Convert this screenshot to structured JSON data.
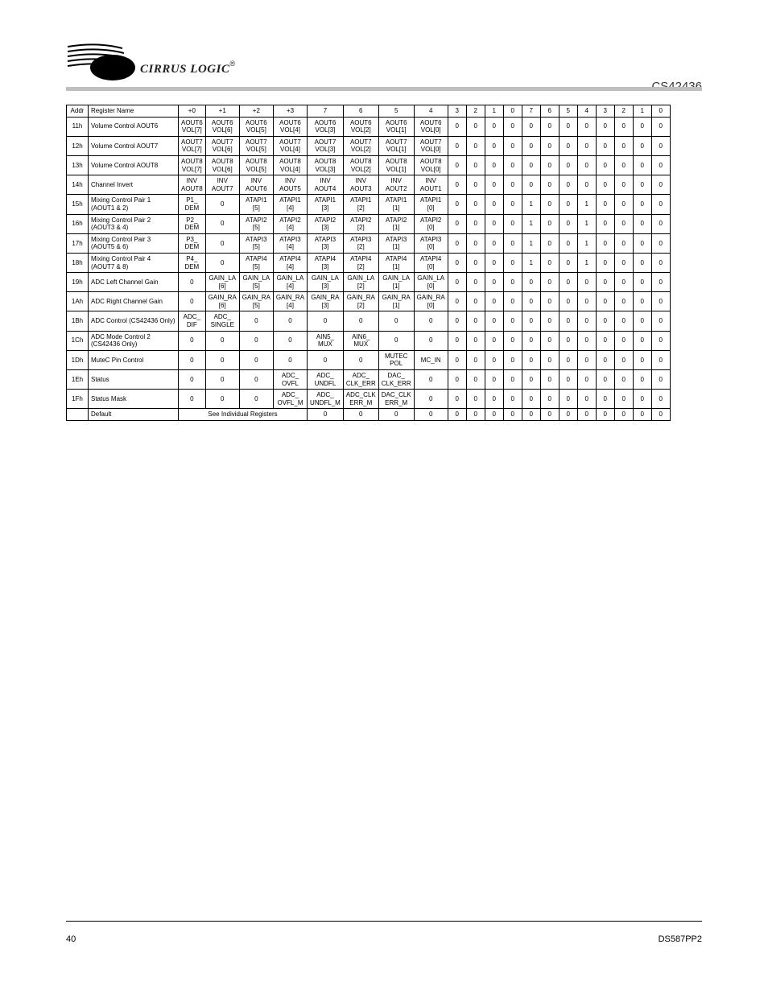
{
  "header": {
    "logo_text": "CIRRUS LOGIC",
    "registered": "®",
    "product_id": "CS42436"
  },
  "table": {
    "head": {
      "addr": "Addr",
      "name": "Register Name",
      "bytes": [
        "+0",
        "+1",
        "+2",
        "+3"
      ],
      "bits": [
        "7",
        "6",
        "5",
        "4",
        "3",
        "2",
        "1",
        "0",
        "7",
        "6",
        "5",
        "4",
        "3",
        "2",
        "1",
        "0"
      ]
    },
    "rows": [
      {
        "addr": "11h",
        "name": "Volume Control AOUT6",
        "b0": [
          "AOUT6\nVOL[7]",
          "AOUT6\nVOL[6]",
          "AOUT6\nVOL[5]",
          "AOUT6\nVOL[4]",
          "AOUT6\nVOL[3]",
          "AOUT6\nVOL[2]",
          "AOUT6\nVOL[1]",
          "AOUT6\nVOL[0]"
        ],
        "b1": [
          "0",
          "0",
          "0",
          "0",
          "0",
          "0",
          "0",
          "0"
        ],
        "b2": [
          "0",
          "0",
          "0",
          "0",
          "0",
          "0",
          "0",
          "0"
        ],
        "b3": [
          "0",
          "0",
          "0",
          "0",
          "0",
          "0",
          "0",
          "0"
        ]
      },
      {
        "addr": "12h",
        "name": "Volume Control AOUT7",
        "b0": [
          "AOUT7\nVOL[7]",
          "AOUT7\nVOL[6]",
          "AOUT7\nVOL[5]",
          "AOUT7\nVOL[4]",
          "AOUT7\nVOL[3]",
          "AOUT7\nVOL[2]",
          "AOUT7\nVOL[1]",
          "AOUT7\nVOL[0]"
        ],
        "b1": [
          "0",
          "0",
          "0",
          "0",
          "0",
          "0",
          "0",
          "0"
        ],
        "b2": [
          "0",
          "0",
          "0",
          "0",
          "0",
          "0",
          "0",
          "0"
        ],
        "b3": [
          "0",
          "0",
          "0",
          "0",
          "0",
          "0",
          "0",
          "0"
        ]
      },
      {
        "addr": "13h",
        "name": "Volume Control AOUT8",
        "b0": [
          "AOUT8\nVOL[7]",
          "AOUT8\nVOL[6]",
          "AOUT8\nVOL[5]",
          "AOUT8\nVOL[4]",
          "AOUT8\nVOL[3]",
          "AOUT8\nVOL[2]",
          "AOUT8\nVOL[1]",
          "AOUT8\nVOL[0]"
        ],
        "b1": [
          "0",
          "0",
          "0",
          "0",
          "0",
          "0",
          "0",
          "0"
        ],
        "b2": [
          "0",
          "0",
          "0",
          "0",
          "0",
          "0",
          "0",
          "0"
        ],
        "b3": [
          "0",
          "0",
          "0",
          "0",
          "0",
          "0",
          "0",
          "0"
        ]
      },
      {
        "addr": "14h",
        "name": "Channel Invert",
        "b0": [
          "INV\nAOUT8",
          "INV\nAOUT7",
          "INV\nAOUT6",
          "INV\nAOUT5",
          "INV\nAOUT4",
          "INV\nAOUT3",
          "INV\nAOUT2",
          "INV\nAOUT1"
        ],
        "b1": [
          "0",
          "0",
          "0",
          "0",
          "0",
          "0",
          "0",
          "0"
        ],
        "b2": [
          "0",
          "0",
          "0",
          "0",
          "0",
          "0",
          "0",
          "0"
        ],
        "b3": [
          "0",
          "0",
          "0",
          "0",
          "0",
          "0",
          "0",
          "0"
        ]
      },
      {
        "addr": "15h",
        "name": "Mixing Control Pair 1 (AOUT1 & 2)",
        "b0": [
          "P1_\nDEM",
          "0",
          "ATAPI1\n[5]",
          "ATAPI1\n[4]",
          "ATAPI1\n[3]",
          "ATAPI1\n[2]",
          "ATAPI1\n[1]",
          "ATAPI1\n[0]"
        ],
        "b1": [
          "0",
          "0",
          "0",
          "0",
          "1",
          "0",
          "0",
          "1"
        ],
        "b2": [
          "0",
          "0",
          "0",
          "0",
          "0",
          "0",
          "0",
          "0"
        ],
        "b3": [
          "0",
          "0",
          "0",
          "0",
          "0",
          "0",
          "0",
          "0"
        ]
      },
      {
        "addr": "16h",
        "name": "Mixing Control Pair 2 (AOUT3 & 4)",
        "b0": [
          "P2_\nDEM",
          "0",
          "ATAPI2\n[5]",
          "ATAPI2\n[4]",
          "ATAPI2\n[3]",
          "ATAPI2\n[2]",
          "ATAPI2\n[1]",
          "ATAPI2\n[0]"
        ],
        "b1": [
          "0",
          "0",
          "0",
          "0",
          "1",
          "0",
          "0",
          "1"
        ],
        "b2": [
          "0",
          "0",
          "0",
          "0",
          "0",
          "0",
          "0",
          "0"
        ],
        "b3": [
          "0",
          "0",
          "0",
          "0",
          "0",
          "0",
          "0",
          "0"
        ]
      },
      {
        "addr": "17h",
        "name": "Mixing Control Pair 3 (AOUT5 & 6)",
        "b0": [
          "P3_\nDEM",
          "0",
          "ATAPI3\n[5]",
          "ATAPI3\n[4]",
          "ATAPI3\n[3]",
          "ATAPI3\n[2]",
          "ATAPI3\n[1]",
          "ATAPI3\n[0]"
        ],
        "b1": [
          "0",
          "0",
          "0",
          "0",
          "1",
          "0",
          "0",
          "1"
        ],
        "b2": [
          "0",
          "0",
          "0",
          "0",
          "0",
          "0",
          "0",
          "0"
        ],
        "b3": [
          "0",
          "0",
          "0",
          "0",
          "0",
          "0",
          "0",
          "0"
        ]
      },
      {
        "addr": "18h",
        "name": "Mixing Control Pair 4 (AOUT7 & 8)",
        "b0": [
          "P4_\nDEM",
          "0",
          "ATAPI4\n[5]",
          "ATAPI4\n[4]",
          "ATAPI4\n[3]",
          "ATAPI4\n[2]",
          "ATAPI4\n[1]",
          "ATAPI4\n[0]"
        ],
        "b1": [
          "0",
          "0",
          "0",
          "0",
          "1",
          "0",
          "0",
          "1"
        ],
        "b2": [
          "0",
          "0",
          "0",
          "0",
          "0",
          "0",
          "0",
          "0"
        ],
        "b3": [
          "0",
          "0",
          "0",
          "0",
          "0",
          "0",
          "0",
          "0"
        ]
      },
      {
        "addr": "19h",
        "name": "ADC Left Channel Gain",
        "b0": [
          "0",
          "GAIN_LA\n[6]",
          "GAIN_LA\n[5]",
          "GAIN_LA\n[4]",
          "GAIN_LA\n[3]",
          "GAIN_LA\n[2]",
          "GAIN_LA\n[1]",
          "GAIN_LA\n[0]"
        ],
        "b1": [
          "0",
          "0",
          "0",
          "0",
          "0",
          "0",
          "0",
          "0"
        ],
        "b2": [
          "0",
          "0",
          "0",
          "0",
          "0",
          "0",
          "0",
          "0"
        ],
        "b3": [
          "0",
          "0",
          "0",
          "0",
          "0",
          "0",
          "0",
          "0"
        ]
      },
      {
        "addr": "1Ah",
        "name": "ADC Right Channel Gain",
        "b0": [
          "0",
          "GAIN_RA\n[6]",
          "GAIN_RA\n[5]",
          "GAIN_RA\n[4]",
          "GAIN_RA\n[3]",
          "GAIN_RA\n[2]",
          "GAIN_RA\n[1]",
          "GAIN_RA\n[0]"
        ],
        "b1": [
          "0",
          "0",
          "0",
          "0",
          "0",
          "0",
          "0",
          "0"
        ],
        "b2": [
          "0",
          "0",
          "0",
          "0",
          "0",
          "0",
          "0",
          "0"
        ],
        "b3": [
          "0",
          "0",
          "0",
          "0",
          "0",
          "0",
          "0",
          "0"
        ]
      },
      {
        "addr": "1Bh",
        "name": "ADC Control (CS42436 Only)",
        "b0": [
          "ADC_\nDIF",
          "ADC_\nSINGLE",
          "0",
          "0",
          "0",
          "0",
          "0",
          "0"
        ],
        "b1": [
          "0",
          "0",
          "0",
          "0",
          "0",
          "0",
          "0",
          "0"
        ],
        "b2": [
          "0",
          "0",
          "0",
          "0",
          "0",
          "0",
          "0",
          "0"
        ],
        "b3": [
          "0",
          "0",
          "0",
          "0",
          "0",
          "0",
          "0",
          "0"
        ]
      },
      {
        "addr": "1Ch",
        "name": "ADC Mode Control 2 (CS42436 Only)",
        "b0": [
          "0",
          "0",
          "0",
          "0",
          "AIN5_\nMUX",
          "AIN6_\nMUX",
          "0",
          "0"
        ],
        "b1": [
          "0",
          "0",
          "0",
          "0",
          "0",
          "0",
          "0",
          "0"
        ],
        "b2": [
          "0",
          "0",
          "0",
          "0",
          "0",
          "0",
          "0",
          "0"
        ],
        "b3": [
          "0",
          "0",
          "0",
          "0",
          "0",
          "0",
          "0",
          "0"
        ]
      },
      {
        "addr": "1Dh",
        "name": "MuteC Pin Control",
        "b0": [
          "0",
          "0",
          "0",
          "0",
          "0",
          "0",
          "MUTEC\nPOL",
          "MC_IN"
        ],
        "b1": [
          "0",
          "0",
          "0",
          "0",
          "0",
          "0",
          "0",
          "0"
        ],
        "b2": [
          "0",
          "0",
          "0",
          "0",
          "0",
          "0",
          "0",
          "0"
        ],
        "b3": [
          "0",
          "0",
          "0",
          "0",
          "0",
          "0",
          "0",
          "0"
        ]
      },
      {
        "addr": "1Eh",
        "name": "Status",
        "b0": [
          "0",
          "0",
          "0",
          "ADC_\nOVFL",
          "ADC_\nUNDFL",
          "ADC_\nCLK_ERR",
          "DAC_\nCLK_ERR",
          "0"
        ],
        "b1": [
          "0",
          "0",
          "0",
          "0",
          "0",
          "0",
          "0",
          "0"
        ],
        "b2": [
          "0",
          "0",
          "0",
          "0",
          "0",
          "0",
          "0",
          "0"
        ],
        "b3": [
          "0",
          "0",
          "0",
          "0",
          "0",
          "0",
          "0",
          "0"
        ]
      },
      {
        "addr": "1Fh",
        "name": "Status Mask",
        "b0": [
          "0",
          "0",
          "0",
          "ADC_\nOVFL_M",
          "ADC_\nUNDFL_M",
          "ADC_CLK\nERR_M",
          "DAC_CLK\nERR_M",
          "0"
        ],
        "b1": [
          "0",
          "0",
          "0",
          "0",
          "0",
          "0",
          "0",
          "0"
        ],
        "b2": [
          "0",
          "0",
          "0",
          "0",
          "0",
          "0",
          "0",
          "0"
        ],
        "b3": [
          "0",
          "0",
          "0",
          "0",
          "0",
          "0",
          "0",
          "0"
        ]
      }
    ],
    "last_row": {
      "addr": "",
      "name": "Default",
      "label": "See Individual Registers",
      "rest": [
        "0",
        "0",
        "0",
        "0",
        "0",
        "0",
        "0",
        "0",
        "0",
        "0",
        "0",
        "0",
        "0",
        "0",
        "0",
        "0",
        "0",
        "0",
        "0",
        "0",
        "0",
        "0",
        "0",
        "0"
      ]
    }
  },
  "footer": {
    "page": "40",
    "doc": "DS587PP2"
  }
}
